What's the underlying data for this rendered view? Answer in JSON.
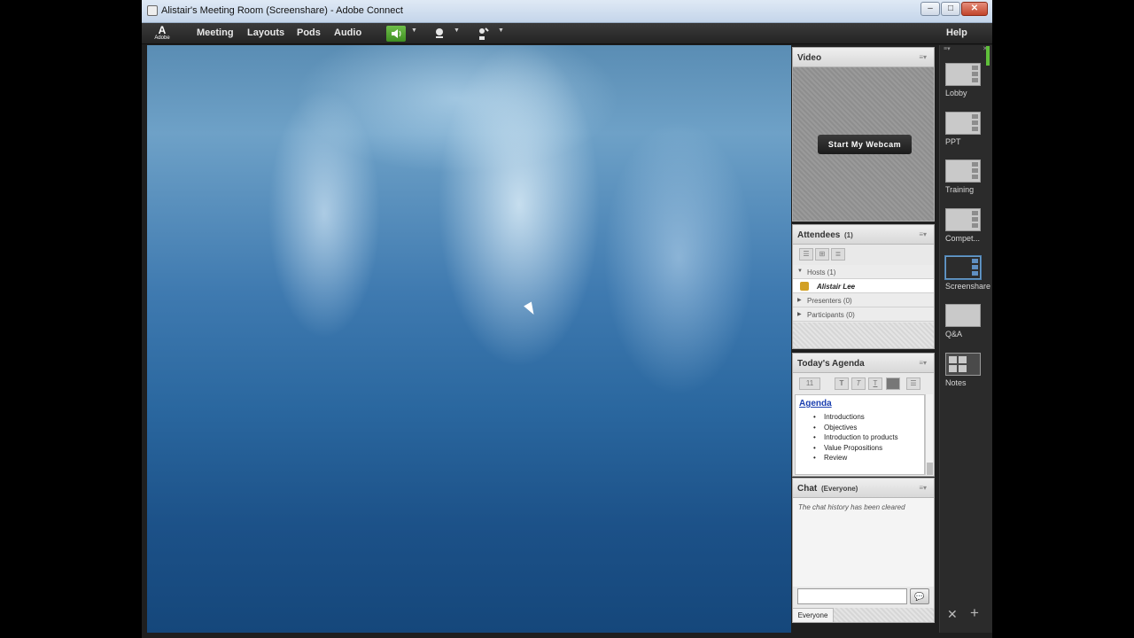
{
  "window": {
    "title": "Alistair's Meeting Room (Screenshare) - Adobe Connect"
  },
  "menubar": {
    "logo_text": "Adobe",
    "items": [
      "Meeting",
      "Layouts",
      "Pods",
      "Audio"
    ],
    "help_label": "Help",
    "audio_icon": "speaker-icon",
    "camera_icon": "webcam-icon",
    "status_icon": "raise-hand-icon"
  },
  "video_pod": {
    "title": "Video",
    "start_button": "Start My Webcam"
  },
  "attendees_pod": {
    "title": "Attendees",
    "count": "(1)",
    "groups": [
      {
        "label": "Hosts (1)",
        "expanded": true,
        "members": [
          "Alistair Lee"
        ]
      },
      {
        "label": "Presenters (0)",
        "expanded": false
      },
      {
        "label": "Participants (0)",
        "expanded": false
      }
    ]
  },
  "agenda_pod": {
    "title": "Today's Agenda",
    "font_size": "11",
    "heading": "Agenda",
    "items": [
      "Introductions",
      "Objectives",
      "Introduction to products",
      "Value Propositions",
      "Review"
    ]
  },
  "chat_pod": {
    "title": "Chat",
    "scope": "(Everyone)",
    "message": "The chat history has been cleared",
    "tab": "Everyone"
  },
  "layouts_rail": {
    "items": [
      "Lobby",
      "PPT",
      "Training",
      "Compet...",
      "Screenshare",
      "Q&A",
      "Notes"
    ],
    "active": "Screenshare"
  },
  "colors": {
    "menubar": "#2e2e2e",
    "accent": "#6a9cc9",
    "audio_active": "#5fbf3a"
  }
}
